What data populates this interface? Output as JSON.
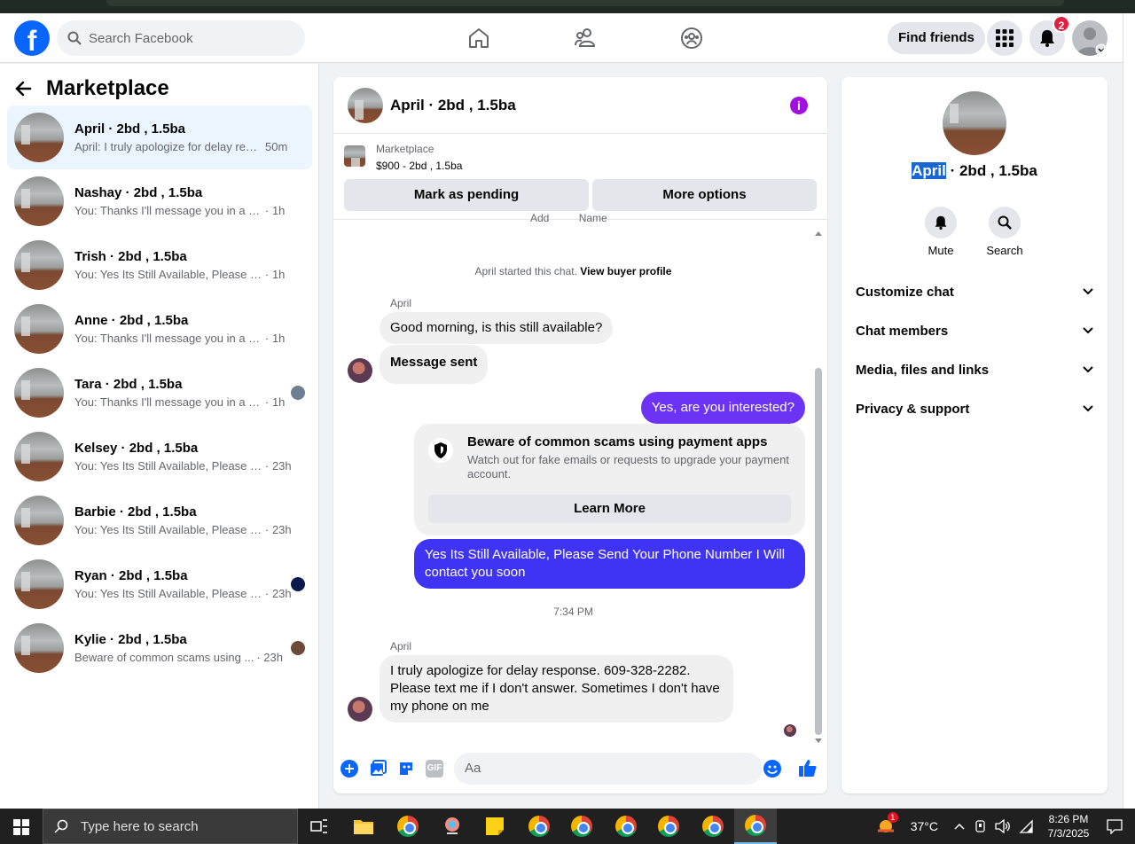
{
  "topbar": {
    "search_placeholder": "Search Facebook",
    "find_friends_label": "Find friends",
    "notifications_count": "2",
    "logo_letter": "f"
  },
  "sidebar": {
    "title": "Marketplace",
    "conversations": [
      {
        "name": "April · 2bd , 1.5ba",
        "preview": "April: I truly apologize for delay resp...",
        "time": "50m"
      },
      {
        "name": "Nashay · 2bd , 1.5ba",
        "preview": "You: Thanks I'll message you in a mo...",
        "time": "· 1h"
      },
      {
        "name": "Trish · 2bd , 1.5ba",
        "preview": "You: Yes Its Still Available, Please Send...",
        "time": "· 1h"
      },
      {
        "name": "Anne · 2bd , 1.5ba",
        "preview": "You: Thanks I'll message you in a mo...",
        "time": "· 1h"
      },
      {
        "name": "Tara · 2bd , 1.5ba",
        "preview": "You: Thanks I'll message you in a m...",
        "time": "· 1h"
      },
      {
        "name": "Kelsey · 2bd , 1.5ba",
        "preview": "You: Yes Its Still Available, Please Sen...",
        "time": "· 23h"
      },
      {
        "name": "Barbie · 2bd , 1.5ba",
        "preview": "You: Yes Its Still Available, Please Sen...",
        "time": "· 23h"
      },
      {
        "name": "Ryan · 2bd , 1.5ba",
        "preview": "You: Yes Its Still Available, Please S...",
        "time": "· 23h"
      },
      {
        "name": "Kylie · 2bd , 1.5ba",
        "preview": "Beware of common scams using ...",
        "time": "· 23h"
      }
    ]
  },
  "chat": {
    "title": "April · 2bd , 1.5ba",
    "listing_source": "Marketplace",
    "listing_price": "$900 - 2bd , 1.5ba",
    "mark_pending_label": "Mark as pending",
    "more_options_label": "More options",
    "cut_text": "Add          Name",
    "started_prefix": "April started this chat.",
    "view_profile_label": "View buyer profile",
    "sender_name": "April",
    "msg1": "Good morning, is this still available?",
    "msg2": "Message sent",
    "msg3": "Yes, are you interested?",
    "scam_title": "Beware of common scams using payment apps",
    "scam_desc": "Watch out for fake emails or requests to upgrade your payment account.",
    "learn_more_label": "Learn More",
    "msg4": "Yes Its Still Available, Please Send Your Phone Number I Will contact you soon",
    "timestamp": "7:34 PM",
    "sender_name2": "April",
    "msg5": "I truly apologize for delay response. 609-328-2282. Please text me if I don't answer. Sometimes I don't have my phone on me",
    "composer_placeholder": "Aa",
    "gif_label": "GIF"
  },
  "details": {
    "name_selected": "April",
    "name_rest": " · 2bd , 1.5ba",
    "mute_label": "Mute",
    "search_label": "Search",
    "sections": [
      "Customize chat",
      "Chat members",
      "Media, files and links",
      "Privacy & support"
    ]
  },
  "taskbar": {
    "search_placeholder": "Type here to search",
    "weather": "37°C",
    "weather_badge": "1",
    "time": "8:26 PM",
    "date": "7/3/2025"
  },
  "colors": {
    "facebook_blue": "#0866ff",
    "out_bubble": "#6c33f5",
    "out_bubble2": "#4034f4",
    "info_icon": "#a30fe0",
    "badge_red": "#e41e3f"
  }
}
